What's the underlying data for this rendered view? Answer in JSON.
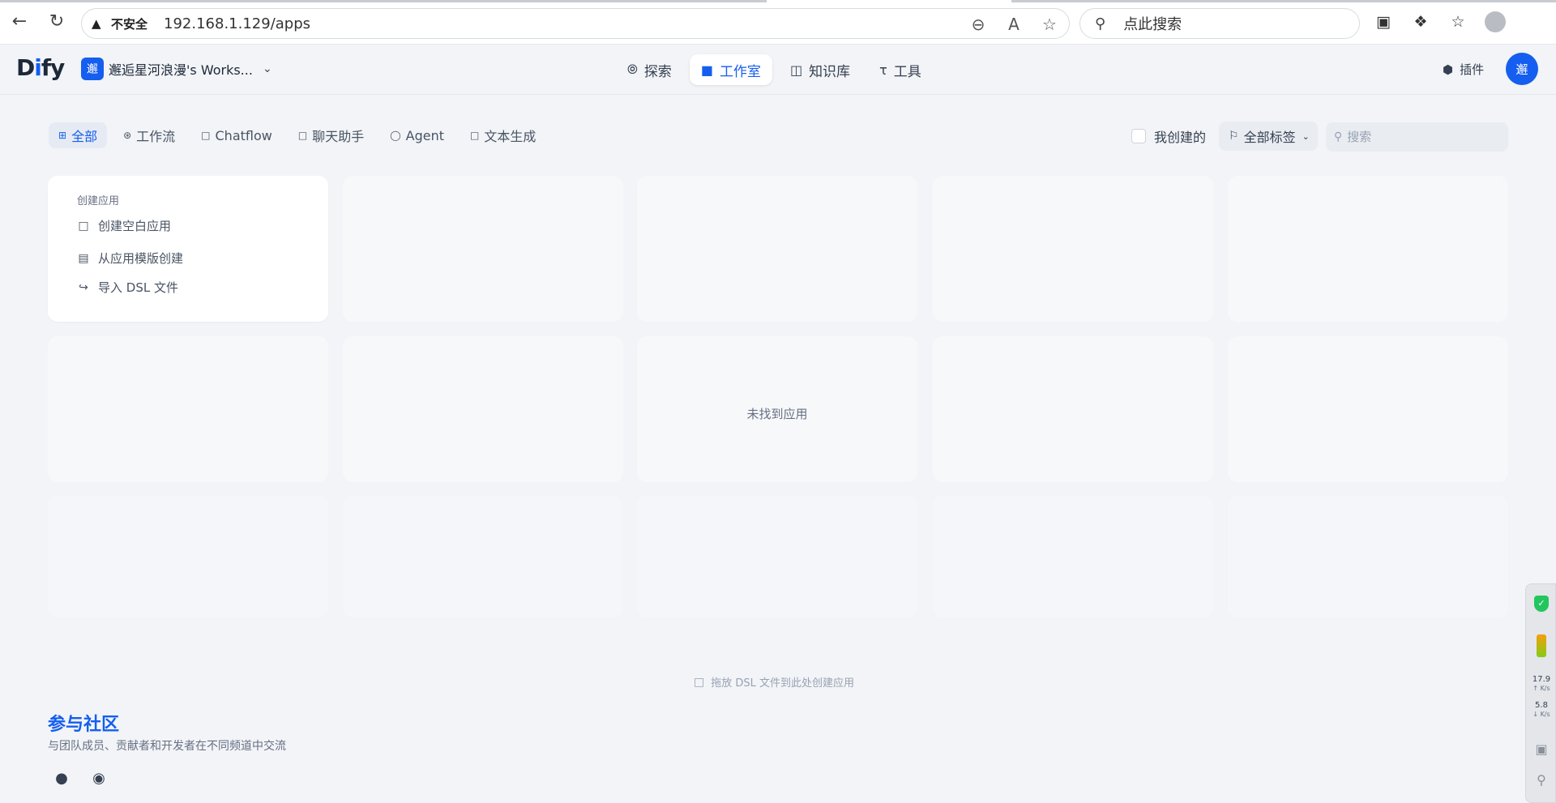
{
  "browser": {
    "url_security": "不安全",
    "url": "192.168.1.129/apps",
    "search_placeholder": "点此搜索"
  },
  "header": {
    "logo_d": "D",
    "logo_i": "i",
    "logo_rest": "fy",
    "workspace_avatar": "邂",
    "workspace_name": "邂逅星河浪漫's Works...",
    "nav": [
      {
        "label": "探索",
        "icon": "explore-icon"
      },
      {
        "label": "工作室",
        "icon": "robot-icon",
        "active": true
      },
      {
        "label": "知识库",
        "icon": "book-icon"
      },
      {
        "label": "工具",
        "icon": "hammer-icon"
      }
    ],
    "plugin_label": "插件",
    "user_avatar": "邂"
  },
  "filters": {
    "tabs": [
      {
        "label": "全部",
        "active": true
      },
      {
        "label": "工作流"
      },
      {
        "label": "Chatflow"
      },
      {
        "label": "聊天助手"
      },
      {
        "label": "Agent"
      },
      {
        "label": "文本生成"
      }
    ],
    "mine_label": "我创建的",
    "tag_label": "全部标签",
    "search_placeholder": "搜索"
  },
  "create_card": {
    "title": "创建应用",
    "items": [
      {
        "label": "创建空白应用",
        "icon": "new-file-icon"
      },
      {
        "label": "从应用模版创建",
        "icon": "template-icon"
      },
      {
        "label": "导入 DSL 文件",
        "icon": "import-icon"
      }
    ]
  },
  "empty_text": "未找到应用",
  "drop_hint": "拖放 DSL 文件到此处创建应用",
  "community": {
    "title": "参与社区",
    "description": "与团队成员、贡献者和开发者在不同频道中交流"
  },
  "side_widget": {
    "up_speed": "17.9",
    "up_unit": "K/s",
    "down_speed": "5.8",
    "down_unit": "K/s"
  },
  "colors": {
    "accent": "#155eef",
    "background": "#f2f4f7"
  }
}
